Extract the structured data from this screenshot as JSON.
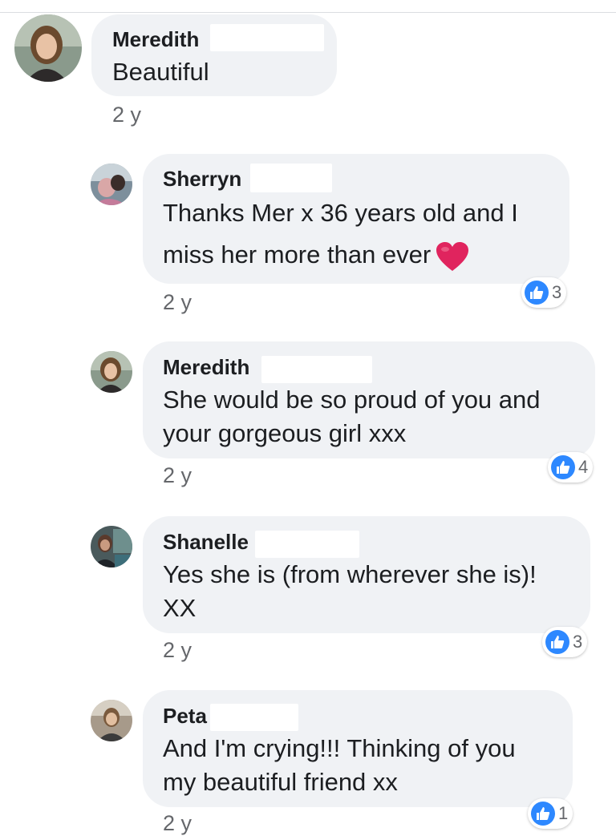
{
  "comments": [
    {
      "name": "Meredith",
      "lines": [
        "Beautiful"
      ],
      "time": "2 y",
      "reactions": null,
      "avatar": "avatar-meredith"
    },
    {
      "name": "Sherryn",
      "lines": [
        "Thanks Mer x 36 years old and I",
        "miss her more than ever"
      ],
      "emoji": "red-heart-emoji",
      "time": "2 y",
      "reactions": {
        "icon": "like-icon",
        "count": "3"
      },
      "avatar": "avatar-sherryn"
    },
    {
      "name": "Meredith",
      "lines": [
        "She would be so proud of you and",
        "your gorgeous girl xxx"
      ],
      "time": "2 y",
      "reactions": {
        "icon": "like-icon",
        "count": "4"
      },
      "avatar": "avatar-meredith"
    },
    {
      "name": "Shanelle",
      "lines": [
        "Yes she is (from wherever she is)!",
        "XX"
      ],
      "time": "2 y",
      "reactions": {
        "icon": "like-icon",
        "count": "3"
      },
      "avatar": "avatar-shanelle"
    },
    {
      "name": "Peta",
      "lines": [
        "And I'm crying!!! Thinking of you",
        "my beautiful friend xx"
      ],
      "time": "2 y",
      "reactions": {
        "icon": "like-icon",
        "count": "1"
      },
      "avatar": "avatar-peta"
    }
  ],
  "colors": {
    "bubble": "#f0f2f5",
    "like_blue": "#2d88ff",
    "meta_gray": "#65676b",
    "heart_red": "#e0245e"
  }
}
